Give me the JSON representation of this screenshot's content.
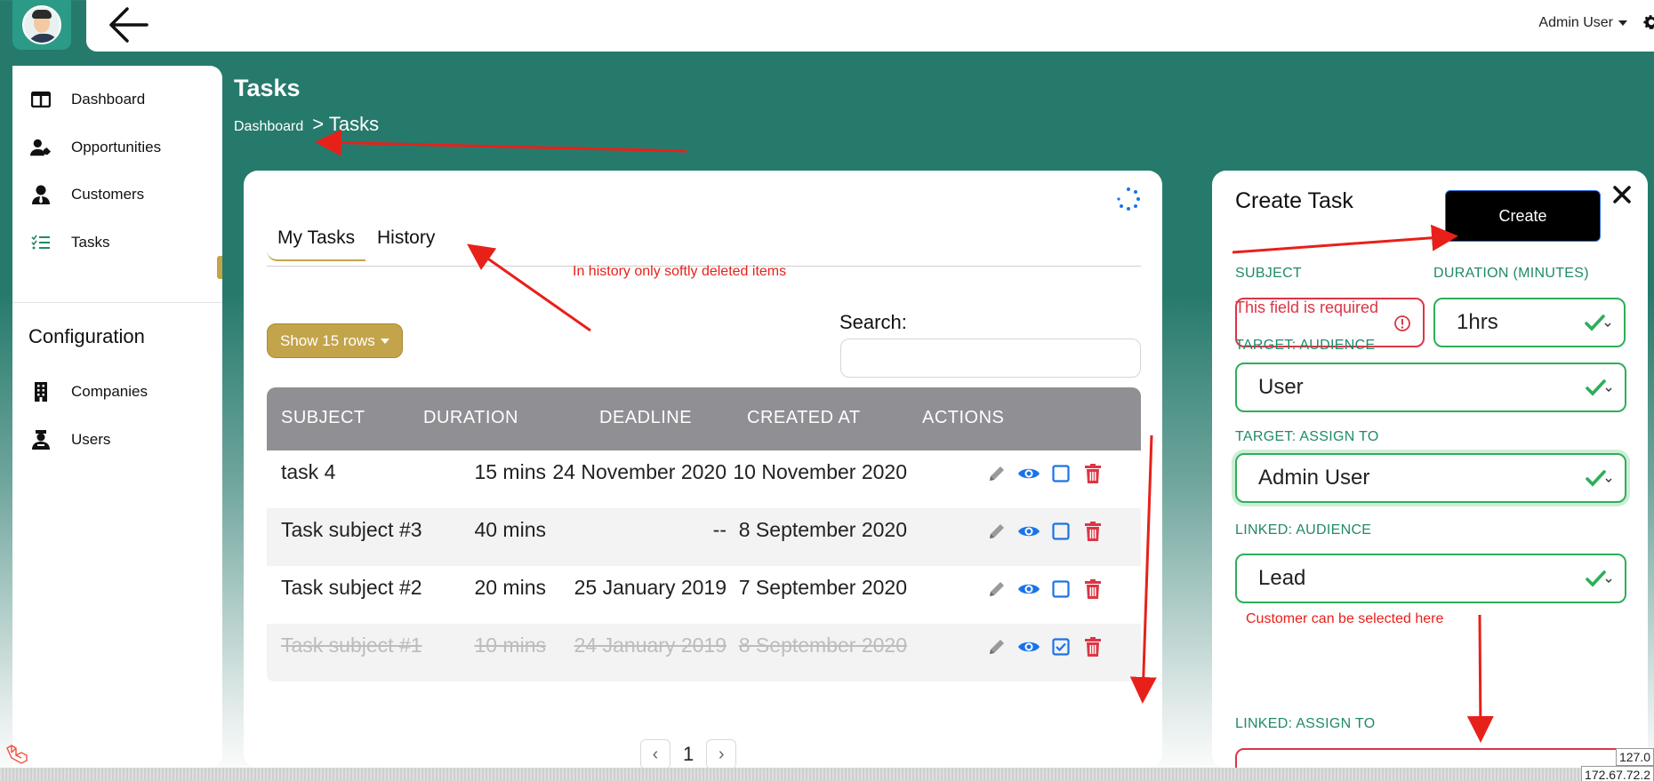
{
  "header": {
    "user_name": "Admin User",
    "icons": [
      "avatar",
      "back-arrow-icon",
      "caret-down-icon",
      "gear-icon"
    ]
  },
  "sidebar": {
    "items": [
      {
        "label": "Dashboard",
        "icon": "columns-icon"
      },
      {
        "label": "Opportunities",
        "icon": "user-tag-icon"
      },
      {
        "label": "Customers",
        "icon": "user-tie-icon"
      },
      {
        "label": "Tasks",
        "icon": "tasks-list-icon"
      }
    ],
    "config_heading": "Configuration",
    "config_items": [
      {
        "label": "Companies",
        "icon": "building-icon"
      },
      {
        "label": "Users",
        "icon": "users-icon"
      }
    ]
  },
  "page": {
    "title": "Tasks",
    "breadcrumb_link": "Dashboard",
    "breadcrumb_current": "> Tasks"
  },
  "tasks_card": {
    "tabs": [
      "My Tasks",
      "History"
    ],
    "show_rows_label": "Show 15 rows",
    "search_label": "Search:",
    "search_value": "",
    "columns": [
      "SUBJECT",
      "DURATION",
      "DEADLINE",
      "CREATED AT",
      "ACTIONS"
    ],
    "rows": [
      {
        "subject": "task 4",
        "duration": "15 mins",
        "deadline": "24 November 2020",
        "created_at": "10 November 2020",
        "done": false
      },
      {
        "subject": "Task subject #3",
        "duration": "40 mins",
        "deadline": "--",
        "created_at": "8 September 2020",
        "done": false
      },
      {
        "subject": "Task subject #2",
        "duration": "20 mins",
        "deadline": "25 January 2019",
        "created_at": "7 September 2020",
        "done": false
      },
      {
        "subject": "Task subject #1",
        "duration": "10 mins",
        "deadline": "24 January 2019",
        "created_at": "8 September 2020",
        "done": true
      }
    ],
    "pagination": {
      "current_page": "1",
      "prev_label": "‹",
      "next_label": "›"
    }
  },
  "create_task": {
    "title": "Create Task",
    "create_button": "Create",
    "subject_label": "SUBJECT",
    "subject_value": "",
    "subject_error": "This field is required",
    "duration_label": "DURATION (MINUTES)",
    "duration_value": "1hrs",
    "target_audience_label": "TARGET: AUDIENCE",
    "target_audience_value": "User",
    "target_assign_label": "TARGET: ASSIGN TO",
    "target_assign_value": "Admin User",
    "linked_audience_label": "LINKED: AUDIENCE",
    "linked_audience_value": "Lead",
    "linked_assign_label": "LINKED: ASSIGN TO"
  },
  "annotations": {
    "history_note": "In history only softly deleted items",
    "customer_note": "Customer can be selected here",
    "annotation_color": "#e8201a"
  },
  "footer": {
    "ip_line1": "127.0",
    "ip_line2": "172.67.72.2"
  },
  "colors": {
    "brand_teal": "#267a6c",
    "accent_gold": "#c4a44a",
    "success_green": "#2eae5a",
    "danger_red": "#dc3545",
    "action_blue": "#1a73e8"
  }
}
